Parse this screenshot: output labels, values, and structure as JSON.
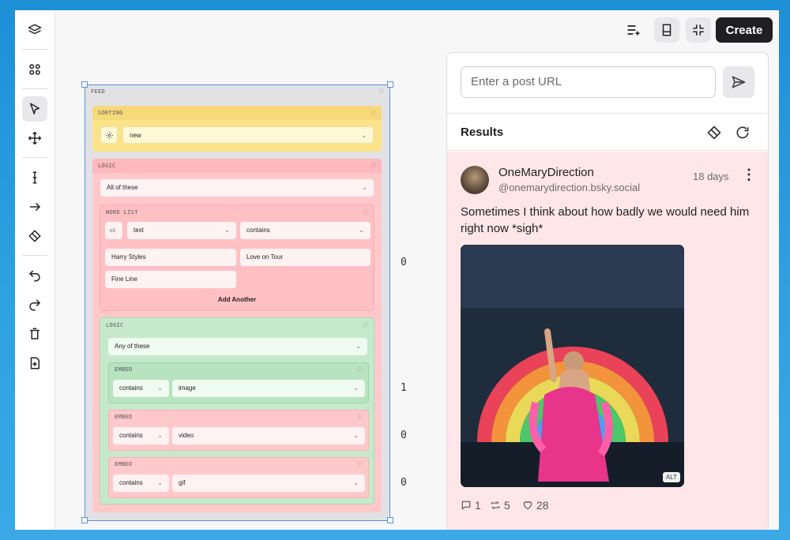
{
  "toolbar": {
    "tools": [
      "layers-icon",
      "apps-icon",
      "pointer-icon",
      "move-icon",
      "text-cursor-icon",
      "arrow-right-icon",
      "eraser-icon",
      "undo-icon",
      "redo-icon",
      "trash-icon",
      "add-page-icon"
    ]
  },
  "header": {
    "create_label": "Create"
  },
  "feed": {
    "label": "FEED",
    "sorting": {
      "label": "SORTING",
      "value": "new"
    },
    "logic": {
      "label": "LOGIC",
      "mode": "All of these",
      "word_list": {
        "label": "WORD LIST",
        "type_tag": "ab",
        "field": "text",
        "operator": "contains",
        "words": [
          "Harry Styles",
          "Love on Tour",
          "Fine Line"
        ],
        "add_label": "Add Another"
      },
      "inner_logic": {
        "label": "LOGIC",
        "mode": "Any of these",
        "embeds": [
          {
            "label": "EMBED",
            "operator": "contains",
            "value": "image"
          },
          {
            "label": "EMBED",
            "operator": "contains",
            "value": "video"
          },
          {
            "label": "EMBED",
            "operator": "contains",
            "value": "gif"
          }
        ]
      }
    },
    "counts": [
      "0",
      "1",
      "0",
      "0"
    ]
  },
  "panel": {
    "url_placeholder": "Enter a post URL",
    "results_label": "Results",
    "post": {
      "display_name": "OneMaryDirection",
      "handle": "@onemarydirection.bsky.social",
      "age": "18 days",
      "text": "Sometimes I think about how badly we would need him right now *sigh*",
      "alt_badge": "ALT",
      "replies": "1",
      "reposts": "5",
      "likes": "28"
    }
  },
  "colors": {
    "sorting_bg": "#fbe38a",
    "logic_red_bg": "#ffc9cc",
    "logic_green_bg": "#c6e9cc",
    "selection": "#5b8fe0",
    "post_bg": "#ffe6e8"
  }
}
